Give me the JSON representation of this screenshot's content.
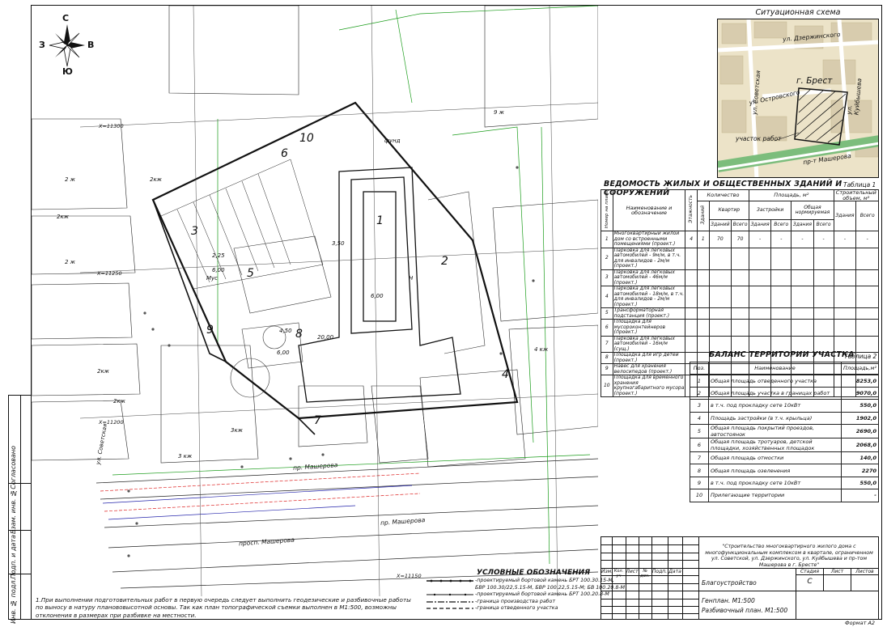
{
  "compass": {
    "n": "С",
    "w": "З",
    "e": "В",
    "s": "Ю"
  },
  "scheme": {
    "title": "Ситуационная схема",
    "labels": {
      "dzerzh": "ул. Дзержинского",
      "sovet": "ул. Советская",
      "kuib": "ул. Куйбышева",
      "ostrov": "ул. Островского",
      "city": "г. Брест",
      "site": "участок работ",
      "masherova": "пр-т Машерова"
    }
  },
  "table1": {
    "title": "ВЕДОМОСТЬ ЖИЛЫХ И ОБЩЕСТВЕННЫХ ЗДАНИЙ И СООРУЖЕНИЙ",
    "tag": "Таблица 1",
    "headers": {
      "num": "Номер на плане",
      "name": "Наименование и обозначение",
      "floors": "Этажность",
      "qty": "Количество",
      "bld": "Зданий",
      "apt": "Квартир",
      "apt_bld": "Зданий",
      "apt_all": "Всего",
      "area": "Площадь, м²",
      "built": "Застройки",
      "gen": "Общая нормируемая",
      "b_bld": "Здания",
      "b_all": "Всего",
      "g_bld": "Здания",
      "g_all": "Всего",
      "vol": "Строительный объем, м³",
      "v_bld": "Здания",
      "v_all": "Всего"
    },
    "rows": [
      {
        "n": "1",
        "name": "Многоквартирный жилой дом со встроенными помещениями (проект.)",
        "fl": "4",
        "b": "1",
        "a1": "70",
        "a2": "70",
        "s1": "-",
        "s2": "-",
        "o1": "-",
        "o2": "-",
        "v1": "-",
        "v2": "-"
      },
      {
        "n": "2",
        "name": "Парковка для легковых автомобилей - 9м/м, в т.ч. для инвалидов - 2м/м (проект.)"
      },
      {
        "n": "3",
        "name": "Парковка для легковых автомобилей - 46м/м (проект.)"
      },
      {
        "n": "4",
        "name": "Парковка для легковых автомобилей - 18м/м, в т.ч. для инвалидов - 2м/м (проект.)"
      },
      {
        "n": "5",
        "name": "Трансформаторная подстанция (проект.)"
      },
      {
        "n": "6",
        "name": "Площадка для мусороконтейнеров (проект.)"
      },
      {
        "n": "7",
        "name": "Парковка для легковых автомобилей - 16м/м (сущ.)"
      },
      {
        "n": "8",
        "name": "Площадка для игр детей (проект.)"
      },
      {
        "n": "9",
        "name": "Навес для хранения велосипедов (проект.)"
      },
      {
        "n": "10",
        "name": "Площадка для временного хранения крупногабаритного мусора (проект.)"
      }
    ]
  },
  "table2": {
    "title": "БАЛАНС ТЕРРИТОРИИ УЧАСТКА",
    "tag": "Таблица 2",
    "h_pos": "Поз.",
    "h_name": "Наименование",
    "h_area": "Площадь,м²",
    "rows": [
      {
        "n": "1",
        "name": "Общая площадь отведенного участка",
        "v": "8253,0"
      },
      {
        "n": "2",
        "name": "Общая площадь участка в границах работ",
        "v": "9070,0"
      },
      {
        "n": "3",
        "name": "в т.ч. под прокладку сете 10кВт",
        "v": "550,0"
      },
      {
        "n": "4",
        "name": "Площадь застройки (в т.ч. крыльца)",
        "v": "1902,0"
      },
      {
        "n": "5",
        "name": "Общая площадь покрытий проездов, автостоянок",
        "v": "2690,0"
      },
      {
        "n": "6",
        "name": "Общая площадь тротуаров, детской площадки, хозяйственных площадок",
        "v": "2068,0"
      },
      {
        "n": "7",
        "name": "Общая площадь отмостки",
        "v": "140,0"
      },
      {
        "n": "8",
        "name": "Общая площадь озеленения",
        "v": "2270"
      },
      {
        "n": "9",
        "name": "в т.ч. под прокладку сете 10кВт",
        "v": "550,0"
      },
      {
        "n": "10",
        "name": "Прилегающие территории",
        "v": "-"
      }
    ]
  },
  "titleblock": {
    "project": "\"Строительство многоквартирного жилого дома с многофункциональным комплексом в квартале, ограниченном ул. Советской, ул. Дзержинского, ул. Куйбышева и пр-том Машерова в г. Бресте\"",
    "cols": [
      "Изм.",
      "Кол. уч",
      "Лист",
      "№ док.",
      "Подп.",
      "Дата"
    ],
    "section": "Благоустройство",
    "stage_h": "Стадия",
    "sheet_h": "Лист",
    "sheets_h": "Листов",
    "stage": "С",
    "sheet_name1": "Генплан. М1:500",
    "sheet_name2": "Разбивочный план. М1:500"
  },
  "legend": {
    "title": "УСЛОВНЫЕ ОБОЗНАЧЕНИЯ",
    "items": [
      "-проектируемый бортовой камень БРТ 100.30.15-М,",
      "БВР 100.30/22,5.15-М, БВР 100.22,5.15-М; БВ 100.20.8-М",
      "-проектируемый бортовой камень БРТ 100.20.8-М",
      "-граница производства работ",
      "-граница отведенного участка"
    ]
  },
  "note": "1.При выполнении подготовительных работ в первую очередь следует выполнить геодезические и разбивочные работы по выносу в натуру планововысотной основы. Так как план топографической съемки выполнен в М1:500, возможны отклонения в размерах при разбивке на местности.",
  "format": "Формат А2",
  "stamp": {
    "s1": "Согласовано",
    "s2": "Взам. инв. №",
    "s3": "Подп. и дата",
    "s4": "Инв. № подл."
  },
  "plan": {
    "streets": {
      "mash1": "пр. Машерова",
      "mash2": "пр. Машерова",
      "mash3": "просп. Машерова",
      "sov": "ул. Советская"
    },
    "grid": {
      "y1": "Х=11300",
      "y2": "Х=11250",
      "y3": "Х=11200",
      "y4": "Х=11150"
    },
    "bldg": {
      "k2a": "2 ж",
      "k2b": "2 ж",
      "k2c": "2кж",
      "k2d": "2кж",
      "k2e": "2кж",
      "k3": "3кж",
      "k3b": "3 кж",
      "k4": "4 кж",
      "k2f": "2кж",
      "k2g": "2 ж",
      "k2h": "2 ж",
      "k9": "9 ж",
      "mus": "Мус",
      "funda": "фунд",
      "zon": "Н"
    },
    "nums": {
      "n1": "1",
      "n2": "2",
      "n3": "3",
      "n4": "4",
      "n5": "5",
      "n6": "6",
      "n7": "7",
      "n8": "8",
      "n9": "9",
      "n10": "10"
    },
    "dims": {
      "d1": "3,50",
      "d2": "6,00",
      "d3": "2,25",
      "d4": "6,00",
      "d5": "4,50",
      "d6": "20,00",
      "d7": "6,00",
      "d8": "3,50"
    }
  }
}
